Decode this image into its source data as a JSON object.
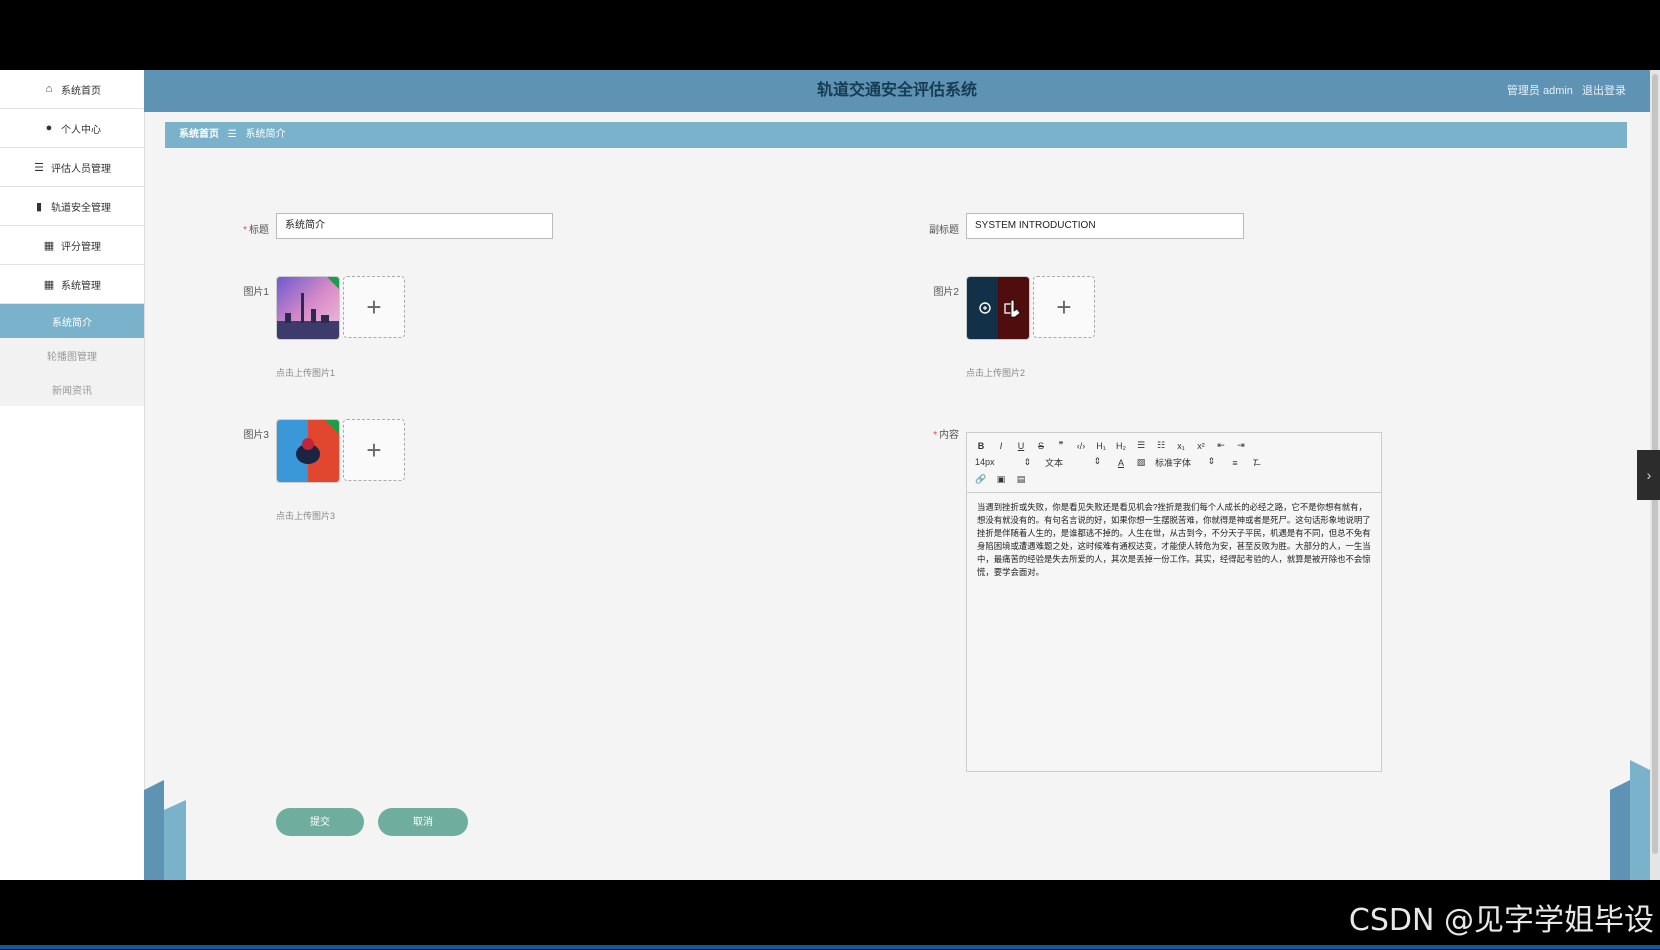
{
  "sidebar": {
    "items": [
      {
        "label": "系统首页",
        "icon": "home-icon",
        "glyph": "⌂"
      },
      {
        "label": "个人中心",
        "icon": "user-icon",
        "glyph": "●"
      },
      {
        "label": "评估人员管理",
        "icon": "sliders-icon",
        "glyph": "☰"
      },
      {
        "label": "轨道安全管理",
        "icon": "bar-chart-icon",
        "glyph": "▮"
      },
      {
        "label": "评分管理",
        "icon": "grid-icon",
        "glyph": "▦"
      },
      {
        "label": "系统管理",
        "icon": "grid-icon",
        "glyph": "▦"
      }
    ],
    "sub_items": [
      {
        "label": "系统简介",
        "active": true
      },
      {
        "label": "轮播图管理",
        "active": false
      },
      {
        "label": "新闻资讯",
        "active": false
      }
    ]
  },
  "header": {
    "title": "轨道交通安全评估系统",
    "user_label": "管理员 admin",
    "logout": "退出登录"
  },
  "breadcrumb": {
    "home": "系统首页",
    "separator": "☰",
    "current": "系统简介"
  },
  "form": {
    "title_label": "标题",
    "title_value": "系统简介",
    "subtitle_label": "副标题",
    "subtitle_value": "SYSTEM INTRODUCTION",
    "image1_label": "图片1",
    "image1_hint": "点击上传图片1",
    "image2_label": "图片2",
    "image2_hint": "点击上传图片2",
    "image3_label": "图片3",
    "image3_hint": "点击上传图片3",
    "content_label": "内容",
    "upload_plus": "+"
  },
  "editor": {
    "toolbar_row1": [
      "B",
      "I",
      "U",
      "S",
      "❞",
      "‹/›",
      "H₁",
      "H₂",
      "☰",
      "☷",
      "x₁",
      "x²",
      "⇤",
      "⇥"
    ],
    "font_size": "14px",
    "block_type": "文本",
    "font_family": "标准字体",
    "toolbar_row3": [
      "🔗",
      "▣",
      "▤"
    ],
    "content": "当遇到挫折或失败，你是看见失败还是看见机会?挫折是我们每个人成长的必经之路，它不是你想有就有，想没有就没有的。有句名言说的好，如果你想一生摆脱苦难，你就得是神或者是死尸。这句话形象地说明了挫折是伴随着人生的，是谁都逃不掉的。人生在世，从古到今，不分天子平民，机遇是有不同，但总不免有身陷困境或遭遇难题之处，这时候难有通权达变，才能使人转危为安，甚至反败为胜。大部分的人，一生当中，最痛苦的经验是失去所爱的人，其次是丢掉一份工作。其实，经得起考验的人，就算是被开除也不会惊慌，要学会面对。"
  },
  "buttons": {
    "submit": "提交",
    "cancel": "取消"
  },
  "watermark": "CSDN @见字学姐毕设",
  "colors": {
    "header": "#5e93b3",
    "breadcrumb": "#7ab2cb",
    "button": "#6fae9e",
    "active_menu": "#7ab2cb"
  }
}
